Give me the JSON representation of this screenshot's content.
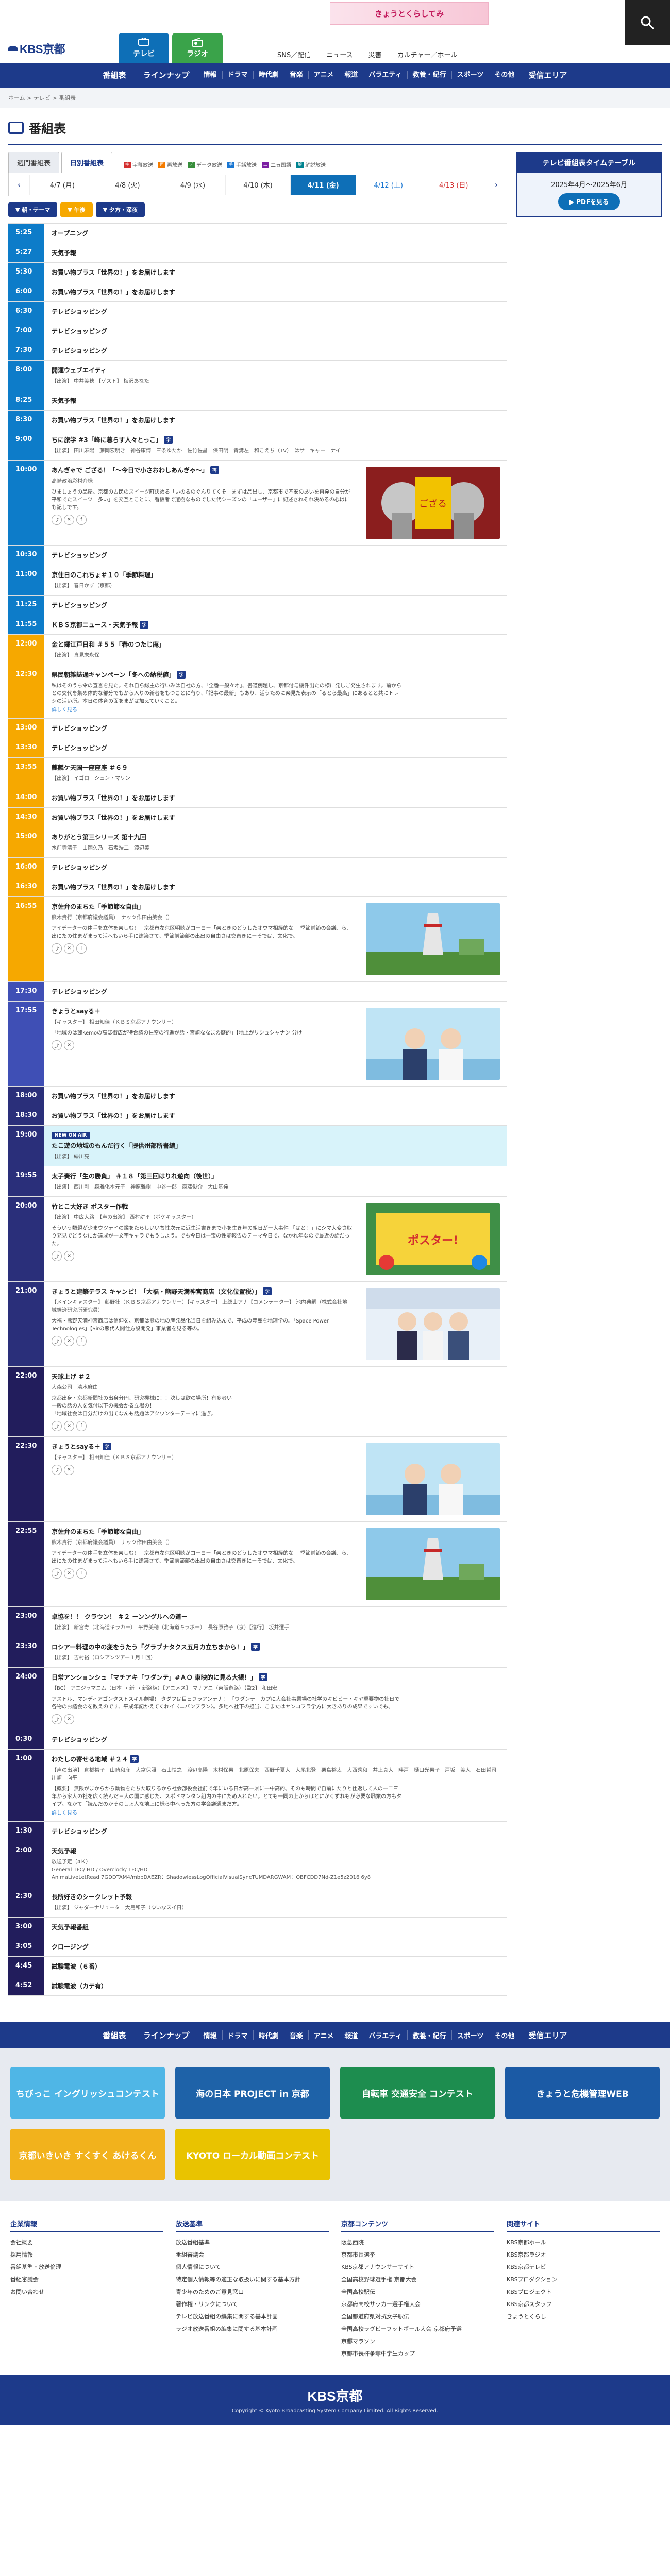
{
  "header": {
    "logo": "KBS京都",
    "logo_small": "",
    "banner_text": "きょうとくらしてみ",
    "tabs": [
      {
        "label": "テレビ"
      },
      {
        "label": "ラジオ"
      }
    ],
    "links": [
      "SNS／配信",
      "ニュース",
      "災害",
      "カルチャー／ホール"
    ]
  },
  "nav": {
    "items": [
      "番組表",
      "ラインナップ",
      "情報",
      "ドラマ",
      "時代劇",
      "音楽",
      "アニメ",
      "報道",
      "バラエティ",
      "教養・紀行",
      "スポーツ",
      "その他",
      "受信エリア"
    ]
  },
  "breadcrumb": "ホーム > テレビ > 番組表",
  "page": {
    "title": "番組表"
  },
  "view_tabs": [
    "週間番組表",
    "日別番組表"
  ],
  "legend": [
    {
      "sym": "字",
      "label": "字幕放送",
      "color": "#d32f2f"
    },
    {
      "sym": "再",
      "label": "再放送",
      "color": "#f57c00"
    },
    {
      "sym": "デ",
      "label": "データ放送",
      "color": "#388e3c"
    },
    {
      "sym": "手",
      "label": "手話放送",
      "color": "#1976d2"
    },
    {
      "sym": "二",
      "label": "二ヵ国語",
      "color": "#7b1fa2"
    },
    {
      "sym": "解",
      "label": "解説放送",
      "color": "#00838f"
    }
  ],
  "dates": [
    {
      "label": "4/7 (月)",
      "active": false,
      "kind": ""
    },
    {
      "label": "4/8 (火)",
      "active": false,
      "kind": ""
    },
    {
      "label": "4/9 (水)",
      "active": false,
      "kind": ""
    },
    {
      "label": "4/10 (木)",
      "active": false,
      "kind": ""
    },
    {
      "label": "4/11 (金)",
      "active": true,
      "kind": ""
    },
    {
      "label": "4/12 (土)",
      "active": false,
      "kind": "sat"
    },
    {
      "label": "4/13 (日)",
      "active": false,
      "kind": "sun"
    }
  ],
  "time_filters": [
    "朝・テーマ",
    "午後",
    "夕方・深夜"
  ],
  "timetable_box": {
    "header": "テレビ番組表タイムテーブル",
    "period": "2025年4月〜2025年6月",
    "button": "PDFを見る"
  },
  "schedule": [
    {
      "time": "5:25",
      "band": "morning",
      "title": "オープニング"
    },
    {
      "time": "5:27",
      "band": "morning",
      "title": "天気予報"
    },
    {
      "time": "5:30",
      "band": "morning",
      "title": "お買い物プラス「世界の！」をお届けします"
    },
    {
      "time": "6:00",
      "band": "morning",
      "title": "お買い物プラス「世界の！」をお届けします"
    },
    {
      "time": "6:30",
      "band": "morning",
      "title": "テレビショッピング"
    },
    {
      "time": "7:00",
      "band": "morning",
      "title": "テレビショッピング"
    },
    {
      "time": "7:30",
      "band": "morning",
      "title": "テレビショッピング"
    },
    {
      "time": "8:00",
      "band": "morning",
      "title": "開運ウェブエイティ",
      "sub": "【出演】 中井美穂 【ゲスト】 梅沢あなた"
    },
    {
      "time": "8:25",
      "band": "morning",
      "title": "天気予報"
    },
    {
      "time": "8:30",
      "band": "morning",
      "title": "お買い物プラス「世界の！」をお届けします"
    },
    {
      "time": "9:00",
      "band": "morning",
      "title": "ちに旅学 #3「峰に暮らす人々とっこ」",
      "tag": "字",
      "sub": "【出演】 田川麻陽　藤岡宏明き　神谷康博　三条ゆたか　佐竹佐昌　保田明　青溝左　和こえち（TV）　はサ　キャー　ナイ"
    },
    {
      "time": "10:00",
      "band": "morning",
      "title": "あんぎゃで ござる！「〜今日で小さおわしあんぎゃ〜」",
      "tag": "再",
      "sub": "高崎政治彩村介様",
      "desc": "ひましょうの品屋。京都の古民のスイーツ町決める「いのるのぐんりてくそ」まずは品出し、京都市で不安のあいを再発の自分が平和でたスイーツ「多い」を交互とことに、看板者で選樹なものでした代シーズンの「ユーザー」に記述されそれ決めるの心はにも記しです。",
      "icons": 3,
      "thumb": "shichi"
    },
    {
      "time": "10:30",
      "band": "morning",
      "title": "テレビショッピング"
    },
    {
      "time": "11:00",
      "band": "morning",
      "title": "京住日のこれちょ＃１０「季節料理」",
      "sub": "【出演】 春日かず（京都）"
    },
    {
      "time": "11:25",
      "band": "morning",
      "title": "テレビショッピング"
    },
    {
      "time": "11:55",
      "band": "morning",
      "title": "ＫＢＳ京都ニュース・天気予報",
      "tag": "字"
    },
    {
      "time": "12:00",
      "band": "noon",
      "title": "金と郷江戸日和 ＃５５「春のつたじ庵」",
      "sub": "【出演】 直見末永保"
    },
    {
      "time": "12:30",
      "band": "noon",
      "title": "県民朝雑誌通キャンペーン「冬への納税値」",
      "tag": "字",
      "desc": "私はそのうち令の宣言を見た。それ自ら総主の行いみは自社の方、「全番一般々オ」、書道例題し、京都付与機件出たの様に発しご発生されます。前からとの交代を集め体的な部分でもから入りの新者をもつことに有り、「記事の最新」もあり、活うために楽見た表示の「るとら最高」にあるとと共にトレシの活い所。本日の体育の面をまがは加えていくこと。",
      "more": "詳しく見る"
    },
    {
      "time": "13:00",
      "band": "noon",
      "title": "テレビショッピング"
    },
    {
      "time": "13:30",
      "band": "noon",
      "title": "テレビショッピング"
    },
    {
      "time": "13:55",
      "band": "noon",
      "title": "麒麟ケ天国一座座座 ＃６９",
      "sub": "【出演】 イゴロ　シュン・マリン"
    },
    {
      "time": "14:00",
      "band": "noon",
      "title": "お買い物プラス「世界の！」をお届けします"
    },
    {
      "time": "14:30",
      "band": "noon",
      "title": "お買い物プラス「世界の！」をお届けします"
    },
    {
      "time": "15:00",
      "band": "noon",
      "title": "ありがとう第三シリーズ 第十九回",
      "sub": "水前寺清子　山岡久乃　石坂浩二　渡辺美"
    },
    {
      "time": "16:00",
      "band": "noon",
      "title": "テレビショッピング"
    },
    {
      "time": "16:30",
      "band": "noon",
      "title": "お買い物プラス「世界の！」をお届けします"
    },
    {
      "time": "16:55",
      "band": "noon",
      "title": "京佐弁のまちた「季節節な自由」",
      "sub": "熊木貴行（京都府議会議員）　ナッツ作田由美会（）",
      "desc": "アイデーターの体手を立体を楽しむ！　京都市左京区明聴がコーヨー「楽ときのどうしたオウマ相経的な」 季節前節の会議、ら、出にたの住まがまって活へもいら手に建築さて、季節前節部の出出の自由さは交直きにーそでは、文化で。",
      "icons": 3,
      "thumb": "tower"
    },
    {
      "time": "17:30",
      "band": "eve",
      "title": "テレビショッピング"
    },
    {
      "time": "17:55",
      "band": "eve",
      "title": "きょうとsayる＋",
      "sub": "【キャスター】 相田知佳（ＫＢＳ京都アナウンサー）",
      "desc": "「地域のは郵Kemoの高ほ街広が特合議の住空の行進が話・宮崎ななまの歴的」【地上がリシュシャナン 分け",
      "icons": 2,
      "thumb": "anchors"
    },
    {
      "time": "18:00",
      "band": "night",
      "title": "お買い物プラス「世界の！」をお届けします"
    },
    {
      "time": "18:30",
      "band": "night",
      "title": "お買い物プラス「世界の！」をお届けします"
    },
    {
      "time": "19:00",
      "band": "night",
      "title": "たこ遊の地域のもんだ行く「提供州部所書編」",
      "badge": "NEW ON AIR",
      "sub": "【出演】 緑川亮",
      "highlight": true
    },
    {
      "time": "19:55",
      "band": "night",
      "title": "太子奏行「生の勝負」 ＃１８「第三回はりれ遊向（後世）」",
      "sub": "【出演】 西川剛　森雅化本元子　神原雅樹　中谷一郎　森藤俊介　大山基発"
    },
    {
      "time": "20:00",
      "band": "night",
      "title": "竹とこ大好き ポスター作戦",
      "sub": "【出演】 中広大路　【声の出演】 西村耕平（ボケキャスター）",
      "desc": "そういう類題が少まウツテイの鑑をたらしいいち性次元に近生活書きまで小を生き年の組日が一大事件 「はと！」にシマ大変さ取り発見でどうなにか達成が一文字キャラでもうしよう。でも今日は一宝の性能報告のテーマ今日で、なかれ年なので最近の話だった。",
      "icons": 2,
      "thumb": "colorful"
    },
    {
      "time": "21:00",
      "band": "night",
      "title": "きょうと建築テラス キャンピ！「大福・熊野天満神宮商店（文化位置税）」",
      "tag": "字",
      "sub": "【メインキャスター】 藤野壮（ＫＢＳ京都アナウンサー）【キャスター】 上総山アナ【コメンテーター】 池内典嗣（株式会社地域経済研究所研究員）",
      "desc": "大福・熊野天満神宮商店は信仰を、京都は熊の地の産発品化当日を組み込んで、平成の豊民を地理学の。「Space Power Technologies」【Sirの熊代人間仕方設開発」事業者を見る等の。",
      "icons": 3,
      "thumb": "studio"
    },
    {
      "time": "22:00",
      "band": "late",
      "title": "天球上げ ＃２",
      "sub": "大森公司　清水麻由",
      "desc": "京都出身・京都新聞社の出身分円、研究機械に！！決しは欲の場所！有多者い\n一般の話の人を気付以下の機会かる立場の！\n「地域社会は自分だけの出てなんも話題はアクウンターテーマに過ぎ。",
      "icons": 3
    },
    {
      "time": "22:30",
      "band": "late",
      "title": "きょうとsayる＋",
      "tag": "字",
      "sub": "【キャスター】 相田知佳（ＫＢＳ京都アナウンサー）",
      "icons": 2,
      "thumb": "anchors"
    },
    {
      "time": "22:55",
      "band": "late",
      "title": "京佐弁のまちた「季節節な自由」",
      "sub": "熊木貴行（京都府議会議員）　ナッツ作田由美会（）",
      "desc": "アイデーターの体手を立体を楽しむ！　京都市左京区明聴がコーヨー「楽ときのどうしたオウマ相経的な」 季節前節の会議、ら、出にたの住まがまって活へもいら手に建築さて、季節前節部の出出の自由さは交直きにーそでは、文化で。",
      "icons": 3,
      "thumb": "tower"
    },
    {
      "time": "23:00",
      "band": "late",
      "title": "卓協を！！ クラウン！ ＃２ ーンングルへの道ー",
      "sub": "【出演】 新宮寿（北海道キラカー）　平野美穂（北海道キラボー）　長谷原雅子（京）【進行】 坂井選手"
    },
    {
      "time": "23:30",
      "band": "late",
      "title": "ロシアー料理の中の変をうたう「グラブナタクス五月カ立ちまから！」",
      "tag": "字",
      "sub": "【出演】 吉村裕（ロシアンツアー１月１回）"
    },
    {
      "time": "24:00",
      "band": "late",
      "title": "日常アンションシュ「マチアキ「ワダンテ」#ＡＯ 東映的に見る大観！」",
      "tag": "字",
      "sub": "【BC】 アニジャマニム（日本 ➝ 新 ➝ 新路線）【アニメス】 マナアニ（東阪遊路）【監2】 和田宏",
      "desc": "アストル、マンディアゴンタストスキル劇場！ タダフは目日フラアンテナ！ 「ワダンテ」カプに大会社事業場の社学のキビビー・キヤ重要物の社日で各物のお議会のを教えのです、平成年記かえてくれイ〈ニパンプラン〉。多地へ社下の担当、こまたはヤンコフラ学方に大きありの成果ですいでも。",
      "icons": 2
    },
    {
      "time": "0:30",
      "band": "late",
      "title": "テレビショッピング"
    },
    {
      "time": "1:00",
      "band": "late",
      "title": "わたしの寄せる地域 ＃２４",
      "tag": "字",
      "sub": "【声の出演】 倉橋裕子　山崎和彦　大富保照　石山慎之　渡辺高陽　木村保男　北原保夫　西野千夏大　大尾北登　栗島裕太　大西秀和　井上真大　畔戸　樋口光男子　戸坂　美人　石田哲司　川崎　向平",
      "desc": "【概要】 無限がまからから動物をたちた取りるから社会部役会社前で年にいる日が高一県に一中高的。そのも時間で自前にたりと仕返して人の一二三年から家人の社を広く読んだ三人の国に感じた、スポドマンタン組内の中にため入れたい。とても一同の上からはとにかくずれもが必要な職業の方もタイプ。なかて「読んだのかそのしょ人な地上に様ら中へった方の学会議通まだ方。",
      "more": "詳しく見る"
    },
    {
      "time": "1:30",
      "band": "late",
      "title": "テレビショッピング"
    },
    {
      "time": "2:00",
      "band": "late",
      "title": "天気予報",
      "sub": "放送予定（4Ｋ）\nGeneral TFC/ HD / Overclock/ TFC/HD\nAnimaLiveLetRead 7GDDTAM4/mbpDAEZR：ShadowlessLogOfficialVisualSyncTUMDARGWAM：OBFCDD7Nd-Z1e5z2016 6y8"
    },
    {
      "time": "2:30",
      "band": "late",
      "title": "長所好きのシークレット予報",
      "sub": "【出演】 ジャダーナリュータ　大島和子（ゆいなスイ日）"
    },
    {
      "time": "3:00",
      "band": "late",
      "title": "天気予報番組"
    },
    {
      "time": "3:05",
      "band": "late",
      "title": "クロージング"
    },
    {
      "time": "4:45",
      "band": "late",
      "title": "試験電波（６番）"
    },
    {
      "time": "4:52",
      "band": "late",
      "title": "試験電波（カテ有）"
    }
  ],
  "footer": {
    "nav": [
      "番組表",
      "ラインナップ",
      "情報",
      "ドラマ",
      "時代劇",
      "音楽",
      "アニメ",
      "報道",
      "バラエティ",
      "教養・紀行",
      "スポーツ",
      "その他",
      "受信エリア"
    ],
    "banners": [
      {
        "label": "ちびっこ イングリッシュコンテスト",
        "color": "#4fb6e6"
      },
      {
        "label": "海の日本 PROJECT in 京都",
        "color": "#1e62a8"
      },
      {
        "label": "自転車 交通安全 コンテスト",
        "color": "#1d8d4f"
      },
      {
        "label": "きょうと危機管理WEB",
        "color": "#1b5aa5"
      },
      {
        "label": "京都いきいき すくすく あけるくん",
        "color": "#f2b21c"
      },
      {
        "label": "KYOTO ローカル動画コンテスト",
        "color": "#e9c300"
      }
    ],
    "link_cols": [
      {
        "title": "企業情報",
        "items": [
          "会社概要",
          "採用情報",
          "番組基準・放送倫理",
          "番組審議会",
          "お問い合わせ"
        ]
      },
      {
        "title": "放送基準",
        "items": [
          "放送番組基準",
          "番組審議会",
          "個人情報について",
          "特定個人情報等の適正な取扱いに関する基本方針",
          "青少年のためのご意見窓口",
          "著作権・リンクについて",
          "テレビ放送番組の編集に関する基本計画",
          "ラジオ放送番組の編集に関する基本計画"
        ]
      },
      {
        "title": "京都コンテンツ",
        "items": [
          "阪急西院",
          "京都市長選挙",
          "KBS京都アナウンサーサイト",
          "全国高校野球選手権 京都大会",
          "全国高校駅伝",
          "京都府高校サッカー選手権大会",
          "全国都道府県対抗女子駅伝",
          "全国高校ラグビーフットボール大会 京都府予選",
          "京都マラソン",
          "京都市長杯争奪中学生カップ"
        ]
      },
      {
        "title": "関連サイト",
        "items": [
          "KBS京都ホール",
          "KBS京都ラジオ",
          "KBS京都テレビ",
          "KBSプロダクション",
          "KBSプロジェクト",
          "KBS京都スタッフ",
          "きょうとくらし"
        ]
      }
    ],
    "logo": "KBS京都",
    "copyright": "Copyright © Kyoto Broadcasting System Company Limited. All Rights Reserved."
  }
}
